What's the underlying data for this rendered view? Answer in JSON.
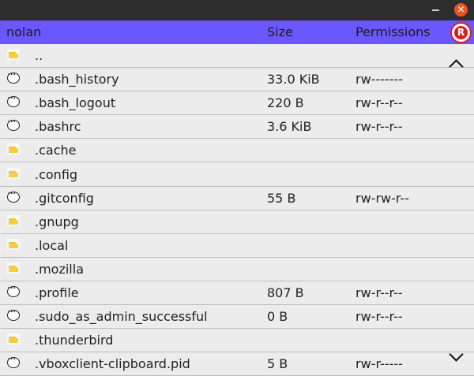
{
  "header": {
    "name": "nolan",
    "size": "Size",
    "permissions": "Permissions",
    "logo_letter": "R"
  },
  "window": {
    "close_glyph": "✕"
  },
  "rows": [
    {
      "type": "folder",
      "name": "..",
      "size": "",
      "perm": ""
    },
    {
      "type": "file",
      "name": ".bash_history",
      "size": "33.0 KiB",
      "perm": "rw-------"
    },
    {
      "type": "file",
      "name": ".bash_logout",
      "size": "220 B",
      "perm": "rw-r--r--"
    },
    {
      "type": "file",
      "name": ".bashrc",
      "size": "3.6 KiB",
      "perm": "rw-r--r--"
    },
    {
      "type": "folder",
      "name": ".cache",
      "size": "",
      "perm": ""
    },
    {
      "type": "folder",
      "name": ".config",
      "size": "",
      "perm": ""
    },
    {
      "type": "file",
      "name": ".gitconfig",
      "size": "55 B",
      "perm": "rw-rw-r--"
    },
    {
      "type": "folder",
      "name": ".gnupg",
      "size": "",
      "perm": ""
    },
    {
      "type": "folder",
      "name": ".local",
      "size": "",
      "perm": ""
    },
    {
      "type": "folder",
      "name": ".mozilla",
      "size": "",
      "perm": ""
    },
    {
      "type": "file",
      "name": ".profile",
      "size": "807 B",
      "perm": "rw-r--r--"
    },
    {
      "type": "file",
      "name": ".sudo_as_admin_successful",
      "size": "0 B",
      "perm": "rw-r--r--"
    },
    {
      "type": "folder",
      "name": ".thunderbird",
      "size": "",
      "perm": ""
    },
    {
      "type": "file",
      "name": ".vboxclient-clipboard.pid",
      "size": "5 B",
      "perm": "rw-r-----"
    }
  ],
  "icons": {
    "folder": "folder-icon",
    "file": "file-icon",
    "scroll_up": "chevron-up-icon",
    "scroll_down": "chevron-down-icon",
    "minimize": "minimize-icon",
    "close": "close-icon",
    "logo": "logo-icon"
  },
  "colors": {
    "header_bg": "#6a57ff",
    "titlebar_bg": "#2d2d2d",
    "close_btn": "#e95420",
    "logo_red": "#d81e1e"
  }
}
